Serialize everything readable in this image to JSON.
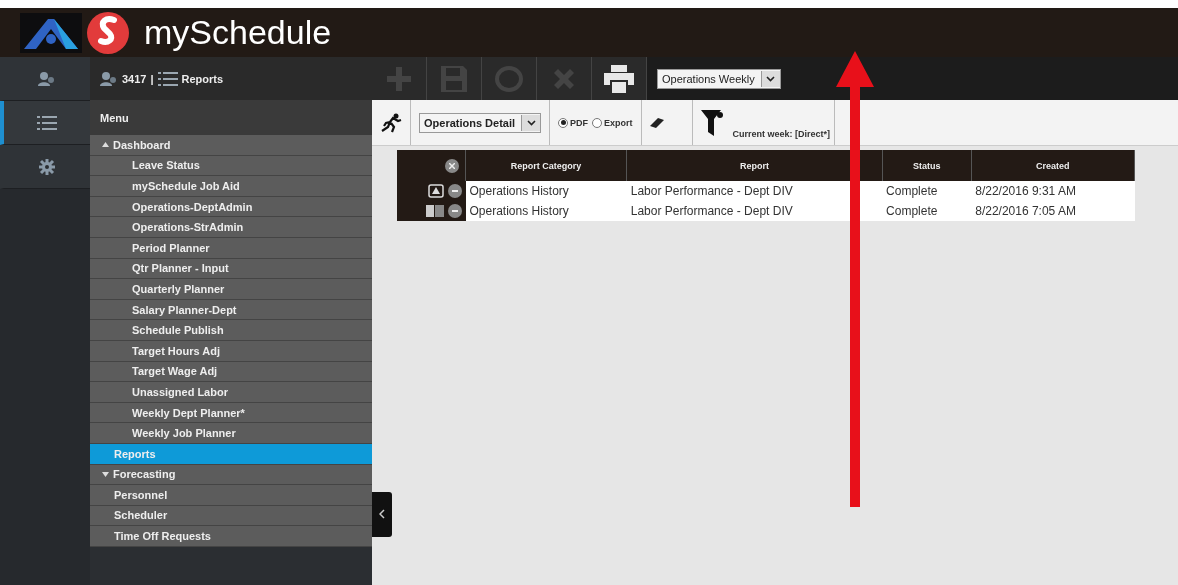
{
  "header": {
    "title": "mySchedule"
  },
  "rail": [
    {
      "selected": false
    },
    {
      "selected": true
    },
    {
      "selected": false
    }
  ],
  "breadcrumb": {
    "store": "3417",
    "separator": "|",
    "page": "Reports"
  },
  "menu": {
    "title": "Menu",
    "items": [
      {
        "label": "Dashboard",
        "expanded": true,
        "selected": false,
        "children": [
          {
            "label": "Leave Status",
            "selected": false
          },
          {
            "label": "mySchedule Job Aid",
            "selected": false
          },
          {
            "label": "Operations-DeptAdmin",
            "selected": false
          },
          {
            "label": "Operations-StrAdmin",
            "selected": false
          },
          {
            "label": "Period Planner",
            "selected": false
          },
          {
            "label": "Qtr Planner - Input",
            "selected": false
          },
          {
            "label": "Quarterly Planner",
            "selected": false
          },
          {
            "label": "Salary Planner-Dept",
            "selected": false
          },
          {
            "label": "Schedule Publish",
            "selected": false
          },
          {
            "label": "Target Hours Adj",
            "selected": false
          },
          {
            "label": "Target Wage Adj",
            "selected": false
          },
          {
            "label": "Unassigned Labor",
            "selected": false
          },
          {
            "label": "Weekly Dept Planner*",
            "selected": false
          },
          {
            "label": "Weekly Job Planner",
            "selected": false
          }
        ]
      },
      {
        "label": "Reports",
        "selected": true
      },
      {
        "label": "Forecasting",
        "expanded": false,
        "selected": false
      },
      {
        "label": "Personnel",
        "selected": false
      },
      {
        "label": "Scheduler",
        "selected": false
      },
      {
        "label": "Time Off Requests",
        "selected": false
      }
    ]
  },
  "toolbar": {
    "buttons": [
      {
        "disabled": true
      },
      {
        "disabled": true
      },
      {
        "disabled": true
      },
      {
        "disabled": true
      },
      {
        "disabled": false
      }
    ],
    "report_set": "Operations Weekly"
  },
  "options": {
    "report_type": "Operations Detail",
    "formats": [
      {
        "label": "PDF",
        "selected": true
      },
      {
        "label": "Export",
        "selected": false
      }
    ],
    "filter": "Current week: [Direct*]"
  },
  "table": {
    "columns": [
      "Report Category",
      "Report",
      "Status",
      "Created"
    ],
    "rows": [
      {
        "kind": "pdf",
        "cells": [
          "Operations History",
          "Labor Performance - Dept DIV",
          "Complete",
          "8/22/2016 9:31 AM"
        ]
      },
      {
        "kind": "excel",
        "cells": [
          "Operations History",
          "Labor Performance - Dept DIV",
          "Complete",
          "8/22/2016 7:05 AM"
        ]
      }
    ]
  }
}
